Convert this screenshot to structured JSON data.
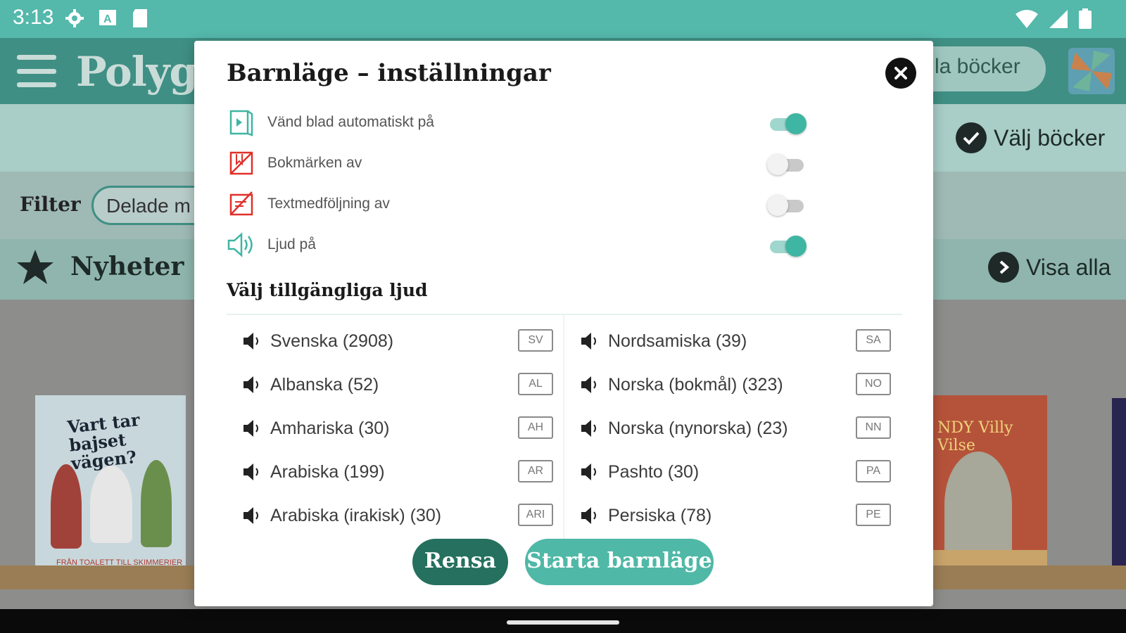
{
  "status_bar": {
    "time": "3:13"
  },
  "app_bar": {
    "logo": "Polygl",
    "all_books_label": "la böcker"
  },
  "select_row": {
    "select_books_label": "Välj böcker"
  },
  "filter_row": {
    "label": "Filter",
    "chip": "Delade m"
  },
  "news_row": {
    "title": "Nyheter",
    "show_all": "Visa alla"
  },
  "books": [
    {
      "cover_text": "Vart tar bajset vägen?",
      "subtitle": "FRÅN TOALETT TILL SKIMMERIER"
    },
    {
      "cover_text": "NDY Villy Vilse"
    }
  ],
  "modal": {
    "title": "Barnläge – inställningar",
    "settings": [
      {
        "label": "Vänd blad automatiskt på",
        "icon": "auto-page-turn-icon",
        "enabled": true
      },
      {
        "label": "Bokmärken av",
        "icon": "bookmark-off-icon",
        "enabled": false
      },
      {
        "label": "Textmedföljning av",
        "icon": "text-follow-off-icon",
        "enabled": false
      },
      {
        "label": "Ljud på",
        "icon": "speaker-icon",
        "enabled": true
      }
    ],
    "sound_heading": "Välj tillgängliga ljud",
    "languages_left": [
      {
        "name": "Svenska (2908)",
        "code": "SV"
      },
      {
        "name": "Albanska (52)",
        "code": "AL"
      },
      {
        "name": "Amhariska (30)",
        "code": "AH"
      },
      {
        "name": "Arabiska (199)",
        "code": "AR"
      },
      {
        "name": "Arabiska (irakisk) (30)",
        "code": "ARI"
      }
    ],
    "languages_right": [
      {
        "name": "Nordsamiska (39)",
        "code": "SA"
      },
      {
        "name": "Norska (bokmål) (323)",
        "code": "NO"
      },
      {
        "name": "Norska (nynorska) (23)",
        "code": "NN"
      },
      {
        "name": "Pashto (30)",
        "code": "PA"
      },
      {
        "name": "Persiska (78)",
        "code": "PE"
      }
    ],
    "clear_button": "Rensa",
    "start_button": "Starta barnläge"
  },
  "colors": {
    "accent": "#4fb8a6",
    "dark_accent": "#25705f",
    "status_bar": "#54b8ab",
    "warning_red": "#e0302a"
  }
}
